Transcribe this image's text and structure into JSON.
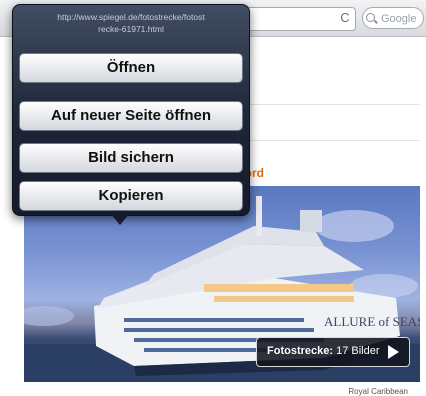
{
  "browser": {
    "search_placeholder": "Google",
    "reload_glyph": "C"
  },
  "popover": {
    "url_line1": "http://www.spiegel.de/fotostrecke/fotost",
    "url_line2": "recke-61971.html",
    "items": [
      {
        "label": "Öffnen"
      },
      {
        "label": "Auf neuer Seite öffnen"
      },
      {
        "label": "Bild sichern"
      },
      {
        "label": "Kopieren"
      }
    ]
  },
  "page": {
    "headline_fragment": "kord",
    "gallery_badge": {
      "label": "Fotostrecke:",
      "count": "17 Bilder"
    },
    "photo_credit": "Royal Caribbean",
    "ship_name": "Allure of the Seas"
  },
  "colors": {
    "headline": "#e06a1c",
    "popover_bg": "#1d2538"
  }
}
